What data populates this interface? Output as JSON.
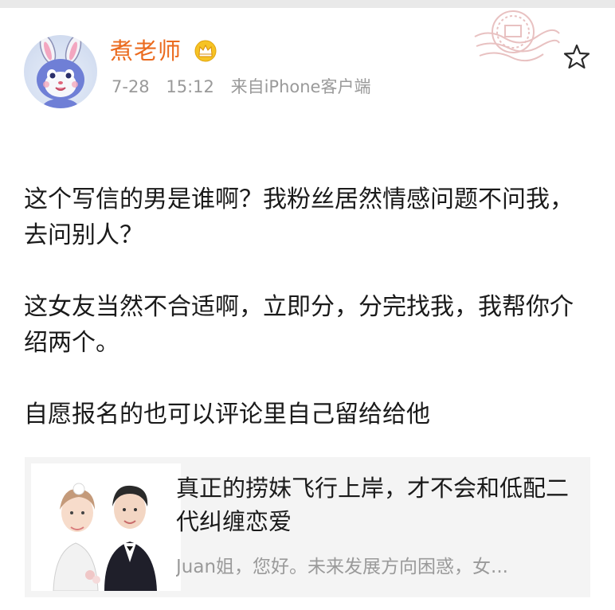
{
  "post": {
    "author": {
      "name": "煮老师",
      "avatar_icon": "bunny-avatar-icon",
      "badge_icon": "crown-badge-icon",
      "name_color": "#eb6b1f"
    },
    "date": "7-28",
    "time": "15:12",
    "source": "来自iPhone客户端",
    "star_icon": "star-outline-icon",
    "stamp_icon": "seal-stamp-icon",
    "paragraphs": [
      "这个写信的男是谁啊？我粉丝居然情感问题不问我，去问别人？",
      "这女友当然不合适啊，立即分，分完找我，我帮你介绍两个。",
      "自愿报名的也可以评论里自己留给给他"
    ],
    "linked_article": {
      "title": "真正的捞妹飞行上岸，才不会和低配二代纠缠恋爱",
      "description": "Juan姐，您好。未来发展方向困惑，女...",
      "thumbnail_icon": "couple-illustration-icon"
    }
  }
}
